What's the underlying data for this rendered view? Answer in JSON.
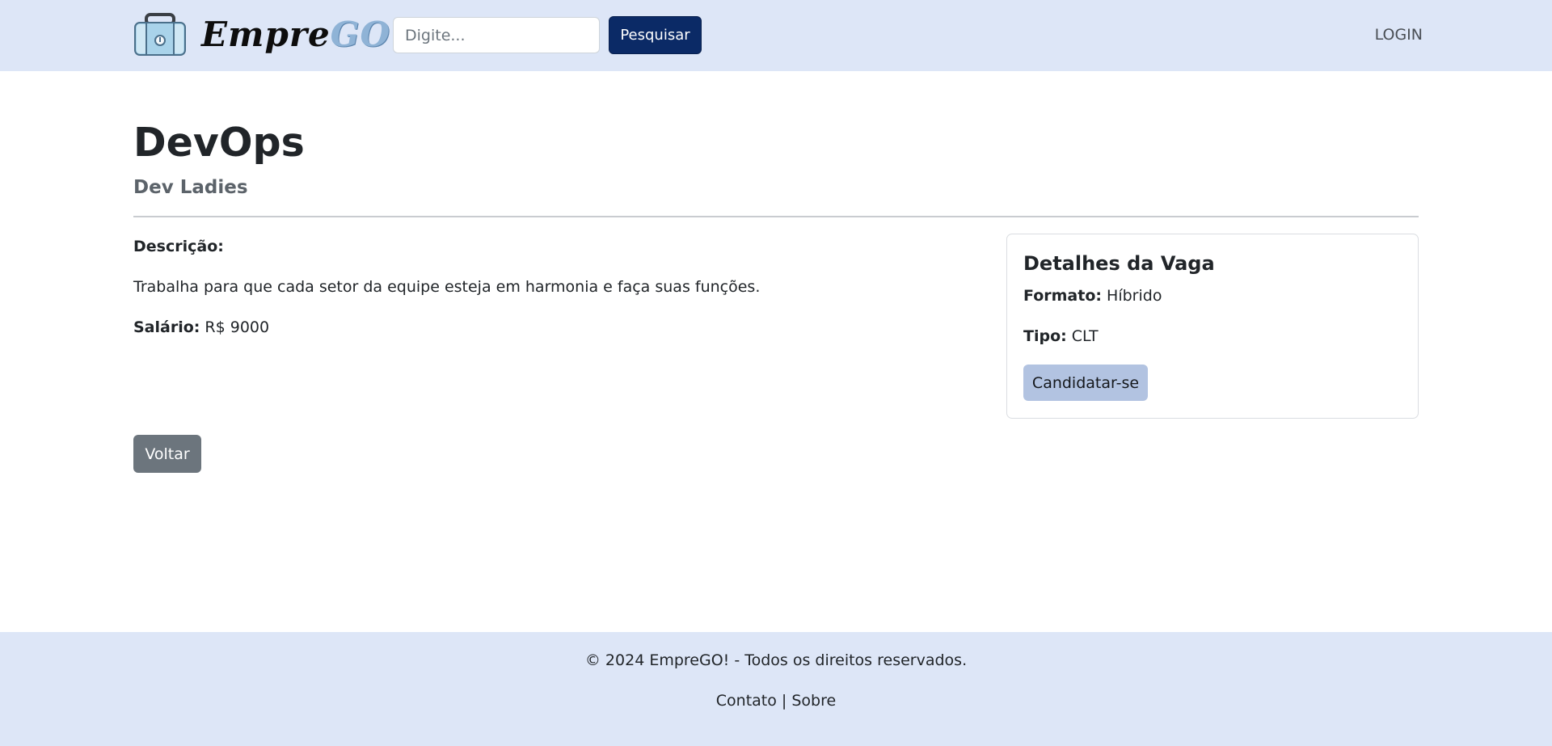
{
  "header": {
    "brand_part1": "Empre",
    "brand_part2": "GO",
    "search_placeholder": "Digite...",
    "search_button": "Pesquisar",
    "login_link": "LOGIN"
  },
  "job": {
    "title": "DevOps",
    "company": "Dev Ladies",
    "description_label": "Descrição:",
    "description": "Trabalha para que cada setor da equipe esteja em harmonia e faça suas funções.",
    "salary_label": "Salário:",
    "salary_value": "R$ 9000"
  },
  "details_card": {
    "title": "Detalhes da Vaga",
    "format_label": "Formato:",
    "format_value": "Híbrido",
    "type_label": "Tipo:",
    "type_value": "CLT",
    "apply_button": "Candidatar-se"
  },
  "back_button": "Voltar",
  "footer": {
    "copyright": "© 2024 EmpreGO! - Todos os direitos reservados.",
    "contact_link": "Contato",
    "separator": "|",
    "about_link": "Sobre"
  },
  "colors": {
    "navbar_bg": "#dde6f7",
    "primary_button": "#0b2a66",
    "apply_button": "#b2c3e1",
    "back_button": "#6c757d"
  },
  "icons": {
    "logo": "briefcase-icon"
  }
}
